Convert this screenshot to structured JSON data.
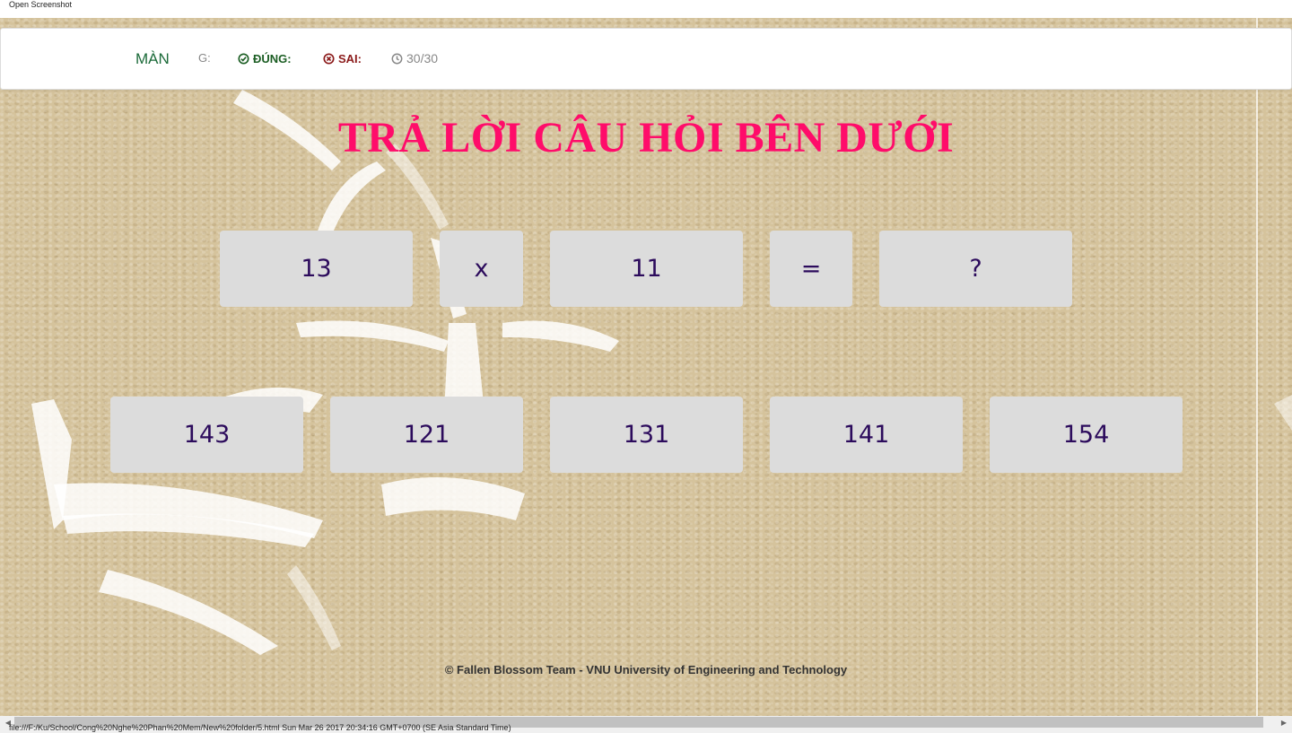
{
  "window": {
    "title": "Open Screenshot"
  },
  "header": {
    "level_label": "MÀN",
    "g_label": "G:",
    "correct_label": "ĐÚNG:",
    "wrong_label": "SAI:",
    "timer_value": "30/30"
  },
  "title": "TRẢ LỜI CÂU HỎI BÊN DƯỚI",
  "equation": {
    "operand_a": "13",
    "operator": "x",
    "operand_b": "11",
    "equals": "=",
    "result": "?"
  },
  "answers": [
    "143",
    "121",
    "131",
    "141",
    "154"
  ],
  "footer": "© Fallen Blossom Team - VNU University of Engineering and Technology",
  "status_url": "file:///F:/Ku/School/Cong%20Nghe%20Phan%20Mem/New%20folder/5.html Sun Mar 26 2017 20:34:16 GMT+0700 (SE Asia Standard Time)",
  "colors": {
    "title": "#ff0c6a",
    "tile_bg": "#dcdcdc",
    "tile_text": "#2c0b5c",
    "correct": "#1c5e24",
    "wrong": "#8b1a1a",
    "background": "#d5c39c"
  },
  "icons": {
    "correct": "check-circle-icon",
    "wrong": "x-circle-icon",
    "timer": "clock-icon"
  }
}
